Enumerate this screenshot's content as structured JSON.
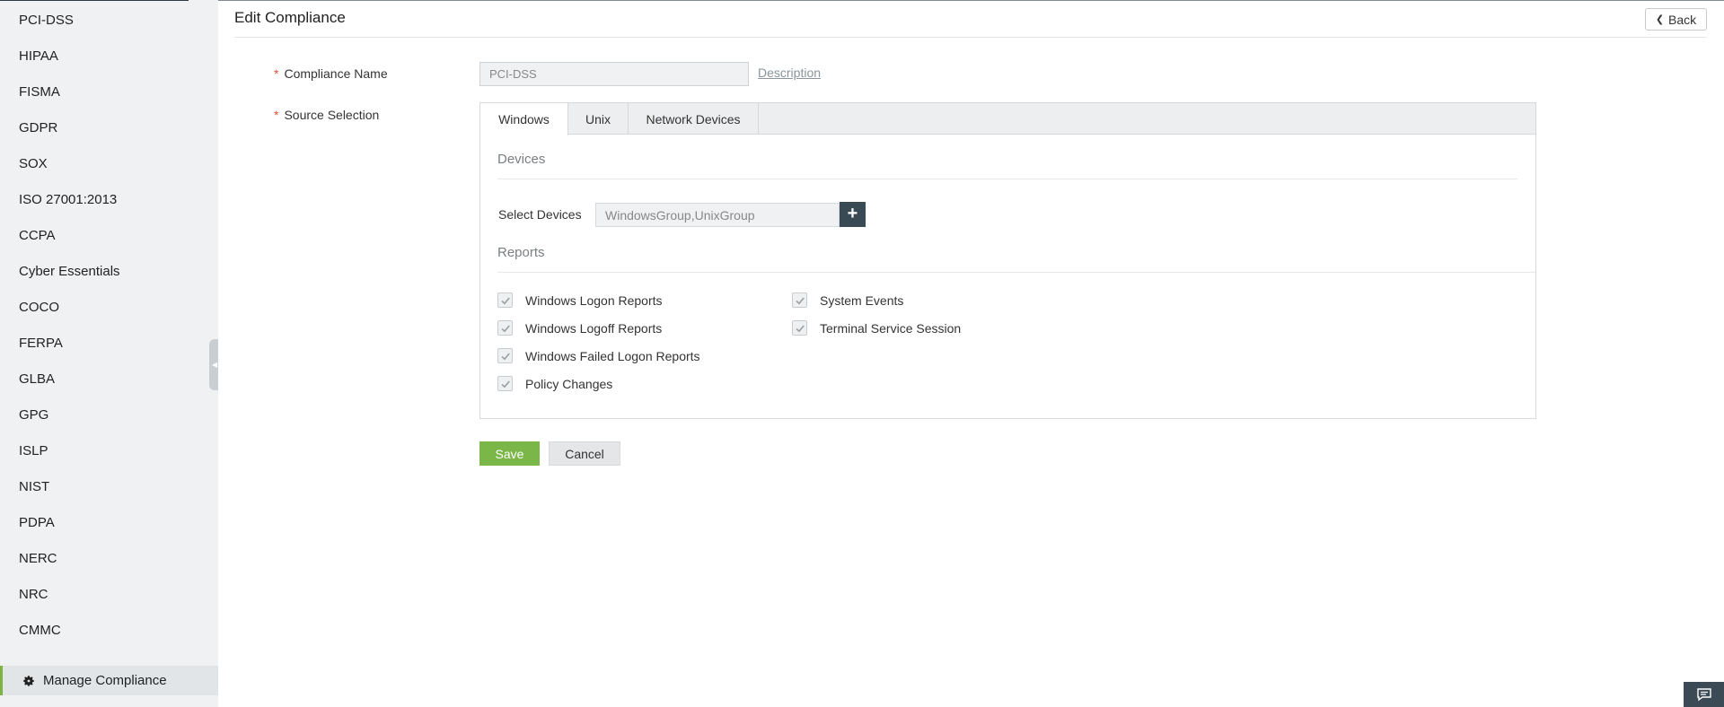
{
  "sidebar": {
    "items": [
      {
        "label": "PCI-DSS"
      },
      {
        "label": "HIPAA"
      },
      {
        "label": "FISMA"
      },
      {
        "label": "GDPR"
      },
      {
        "label": "SOX"
      },
      {
        "label": "ISO 27001:2013"
      },
      {
        "label": "CCPA"
      },
      {
        "label": "Cyber Essentials"
      },
      {
        "label": "COCO"
      },
      {
        "label": "FERPA"
      },
      {
        "label": "GLBA"
      },
      {
        "label": "GPG"
      },
      {
        "label": "ISLP"
      },
      {
        "label": "NIST"
      },
      {
        "label": "PDPA"
      },
      {
        "label": "NERC"
      },
      {
        "label": "NRC"
      },
      {
        "label": "CMMC"
      }
    ],
    "manage_label": "Manage Compliance"
  },
  "header": {
    "title": "Edit Compliance",
    "back_label": "Back"
  },
  "form": {
    "required_mark": "*",
    "name_label": "Compliance Name",
    "name_value": "PCI-DSS",
    "description_link": "Description",
    "source_label": "Source Selection",
    "tabs": [
      {
        "label": "Windows",
        "active": true
      },
      {
        "label": "Unix",
        "active": false
      },
      {
        "label": "Network Devices",
        "active": false
      }
    ],
    "devices_title": "Devices",
    "select_devices_label": "Select Devices",
    "select_devices_value": "WindowsGroup,UnixGroup",
    "add_symbol": "+",
    "reports_title": "Reports",
    "reports": [
      {
        "label": "Windows Logon Reports",
        "checked": true
      },
      {
        "label": "Windows Logoff Reports",
        "checked": true
      },
      {
        "label": "Windows Failed Logon Reports",
        "checked": true
      },
      {
        "label": "Policy Changes",
        "checked": true
      },
      {
        "label": "System Events",
        "checked": true
      },
      {
        "label": "Terminal Service Session",
        "checked": true
      }
    ],
    "save_label": "Save",
    "cancel_label": "Cancel"
  },
  "colors": {
    "accent_green": "#7ab648",
    "dark": "#3a4a55",
    "required": "#e0533c"
  }
}
